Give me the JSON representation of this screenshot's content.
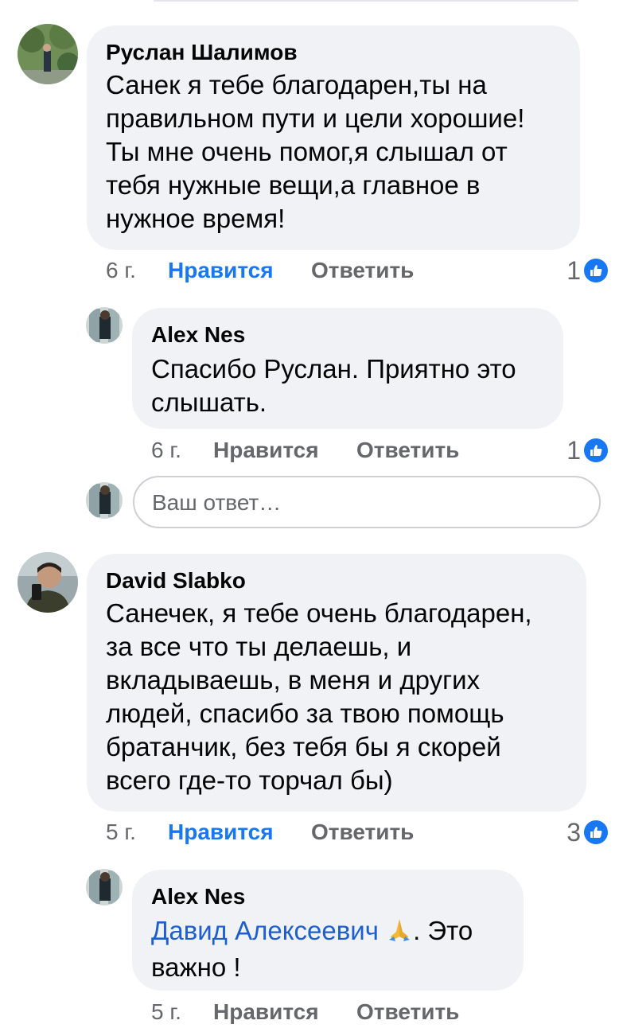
{
  "comments": [
    {
      "author": "Руслан Шалимов",
      "lines": [
        "Санек я тебе благодарен,ты на",
        "правильном пути и цели хорошие!",
        "Ты мне очень помог,я слышал от",
        "тебя нужные вещи,а главное в",
        "нужное время!"
      ],
      "time": "6 г.",
      "like": "Нравится",
      "reply": "Ответить",
      "reactions": "1",
      "avatar_icon": "user-avatar-park-photo"
    },
    {
      "author": "Alex Nes",
      "lines": [
        "Спасибо Руслан. Приятно это",
        "слышать."
      ],
      "time": "6 г.",
      "like": "Нравится",
      "reply": "Ответить",
      "reactions": "1",
      "avatar_icon": "user-avatar-window-photo"
    },
    {
      "author": "David Slabko",
      "lines": [
        "Санечек, я тебе очень благодарен,",
        "за все что ты делаешь, и",
        "вкладываешь, в меня и других",
        "людей, спасибо за твою помощь",
        "братанчик, без тебя бы я скорей",
        "всего где-то торчал бы)"
      ],
      "time": "5 г.",
      "like": "Нравится",
      "reply": "Ответить",
      "reactions": "3",
      "avatar_icon": "user-avatar-selfie-photo"
    },
    {
      "author": "Alex Nes",
      "mention": "Давид Алексеевич",
      "emoji": "🙏",
      "after_mention": ". Это",
      "line2": "важно !",
      "time": "5 г.",
      "like": "Нравится",
      "reply": "Ответить",
      "avatar_icon": "user-avatar-window-photo"
    }
  ],
  "reply_input": {
    "placeholder": "Ваш ответ…",
    "avatar_icon": "user-avatar-window-photo"
  },
  "colors": {
    "bubble": "#f0f2f5",
    "link_blue": "#1877f2",
    "mention_blue": "#1d5fd1",
    "meta_gray": "#65676b"
  }
}
